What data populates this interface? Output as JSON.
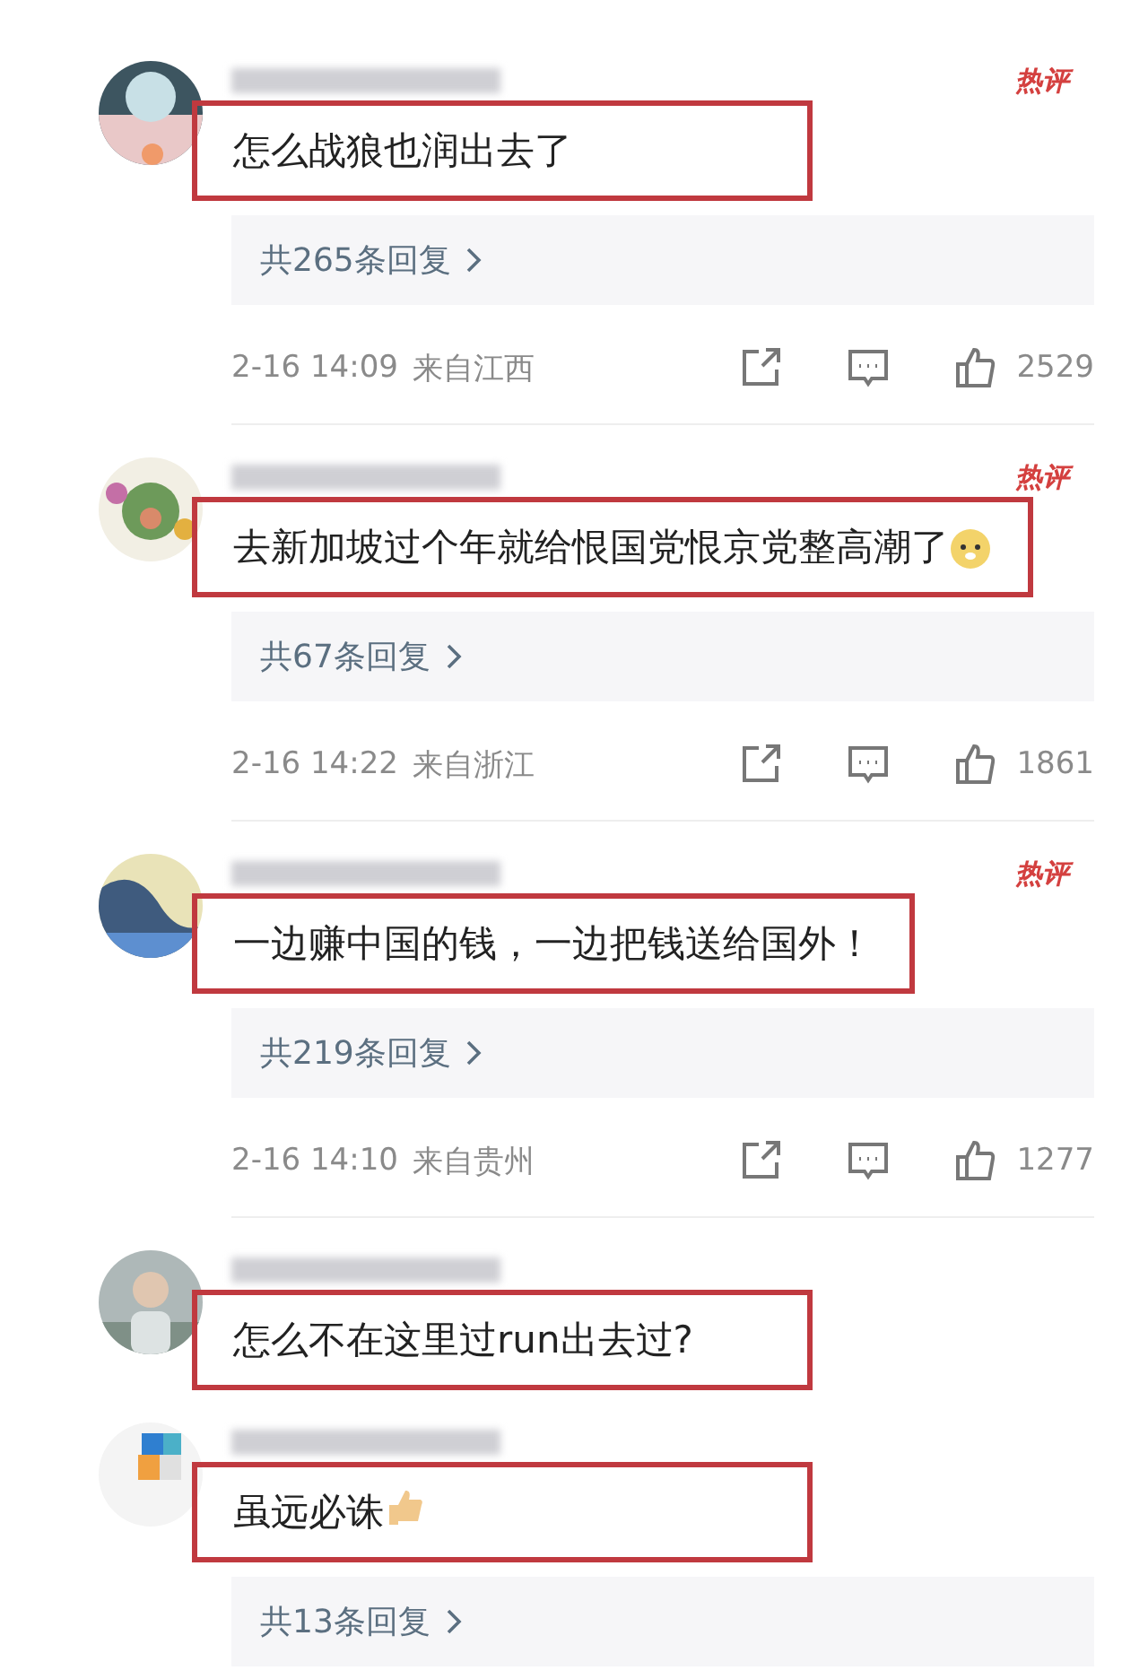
{
  "comments": [
    {
      "hot_badge": "热评",
      "text": "怎么战狼也润出去了",
      "highlighted": true,
      "replies": "共265条回复",
      "meta": {
        "time": "2-16 14:09",
        "location": "来自江西",
        "likes": "2529"
      }
    },
    {
      "hot_badge": "热评",
      "text": "去新加坡过个年就给恨国党恨京党整高潮了",
      "sticker": {
        "kind": "dog"
      },
      "highlighted": true,
      "replies": "共67条回复",
      "meta": {
        "time": "2-16 14:22",
        "location": "来自浙江",
        "likes": "1861"
      }
    },
    {
      "hot_badge": "热评",
      "text": "一边赚中国的钱，一边把钱送给国外！",
      "highlighted": true,
      "replies": "共219条回复",
      "meta": {
        "time": "2-16 14:10",
        "location": "来自贵州",
        "likes": "1277"
      }
    },
    {
      "text": "怎么不在这里过run出去过?",
      "highlighted": true
    },
    {
      "text": "虽远必诛",
      "sticker": {
        "kind": "thumb"
      },
      "highlighted": true,
      "replies": "共13条回复"
    }
  ]
}
